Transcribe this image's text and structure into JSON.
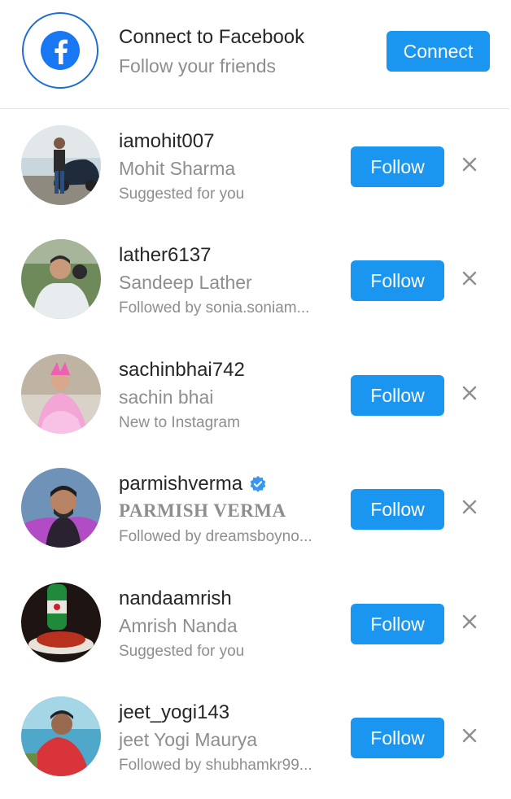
{
  "facebook": {
    "title": "Connect to Facebook",
    "subtitle": "Follow your friends",
    "button_label": "Connect",
    "icon": "facebook-icon"
  },
  "suggestions": [
    {
      "username": "iamohit007",
      "full_name": "Mohit Sharma",
      "context": "Suggested for you",
      "follow_label": "Follow",
      "verified": false
    },
    {
      "username": "lather6137",
      "full_name": "Sandeep Lather",
      "context": "Followed by sonia.soniam...",
      "follow_label": "Follow",
      "verified": false
    },
    {
      "username": "sachinbhai742",
      "full_name": "sachin bhai",
      "context": "New to Instagram",
      "follow_label": "Follow",
      "verified": false
    },
    {
      "username": "parmishverma",
      "full_name": "PARMISH VERMA",
      "context": "Followed by dreamsboyno...",
      "follow_label": "Follow",
      "verified": true
    },
    {
      "username": "nandaamrish",
      "full_name": "Amrish Nanda",
      "context": "Suggested for you",
      "follow_label": "Follow",
      "verified": false
    },
    {
      "username": "jeet_yogi143",
      "full_name": "jeet Yogi Maurya",
      "context": "Followed by shubhamkr99...",
      "follow_label": "Follow",
      "verified": false
    }
  ],
  "colors": {
    "accent": "#1a96f0",
    "facebook_blue": "#1f6fd1",
    "secondary_text": "#8e8e8e",
    "verified": "#3897f0"
  }
}
